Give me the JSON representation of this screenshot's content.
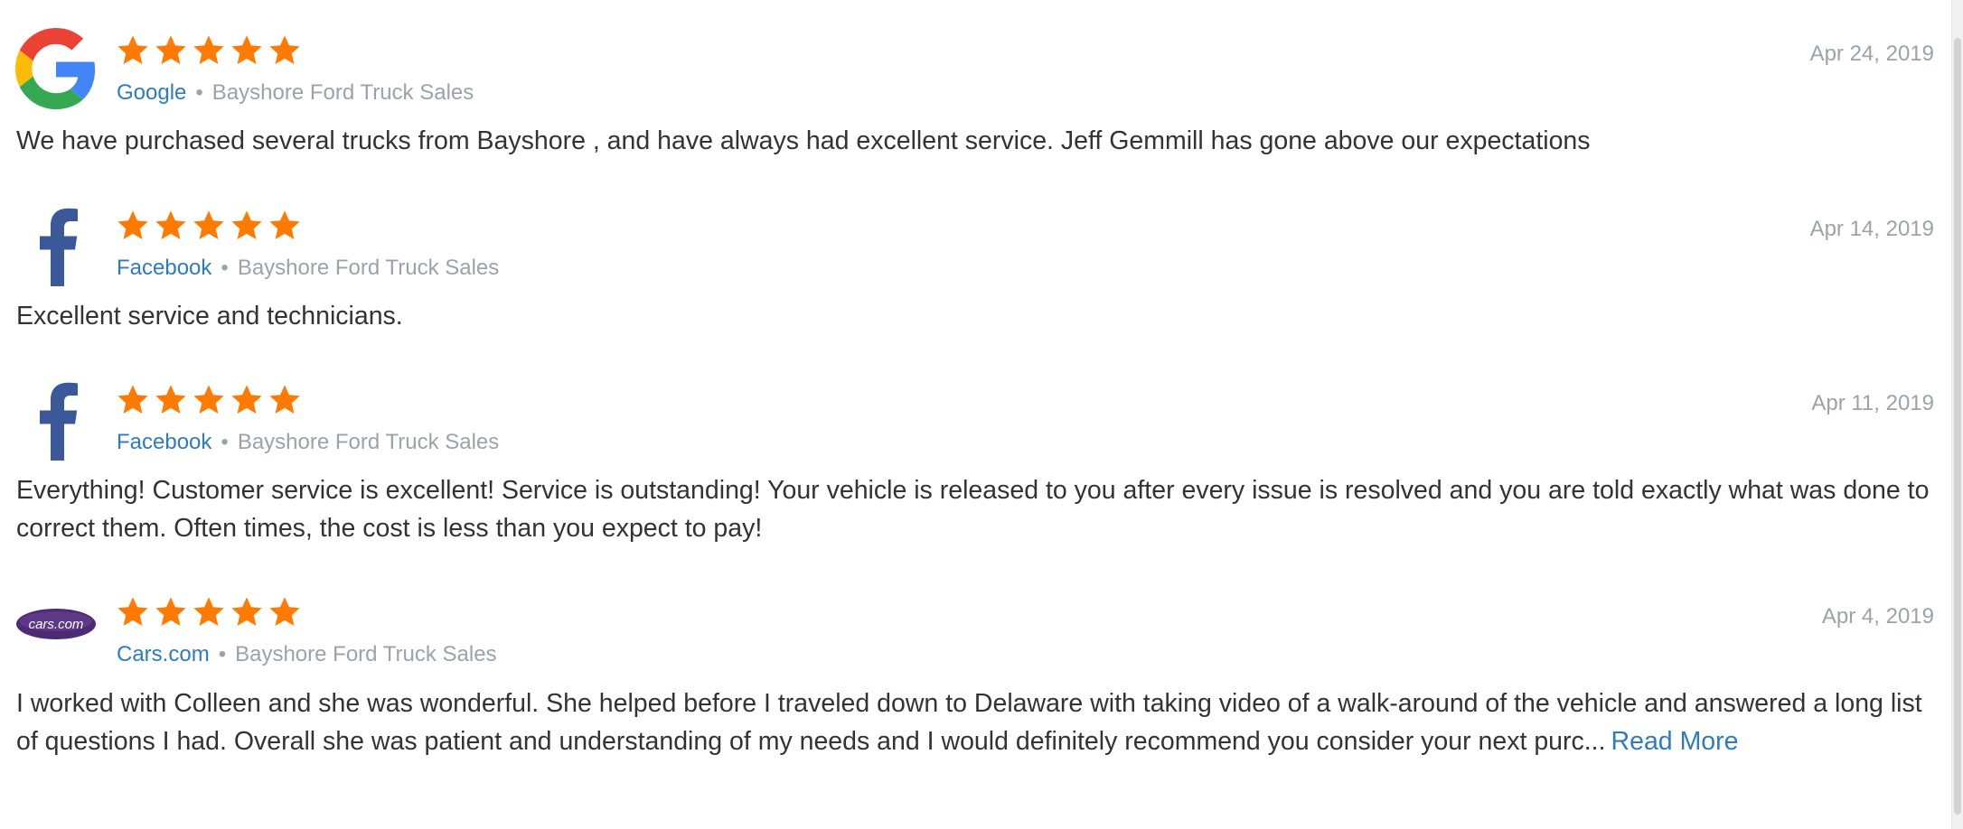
{
  "reviews": [
    {
      "source": "Google",
      "business": "Bayshore Ford Truck Sales",
      "date": "Apr 24, 2019",
      "rating": 5,
      "text": "We have purchased several trucks from Bayshore , and have always had excellent service. Jeff Gemmill has gone above our expectations",
      "icon": "google-icon"
    },
    {
      "source": "Facebook",
      "business": "Bayshore Ford Truck Sales",
      "date": "Apr 14, 2019",
      "rating": 5,
      "text": "Excellent service and technicians.",
      "icon": "facebook-icon"
    },
    {
      "source": "Facebook",
      "business": "Bayshore Ford Truck Sales",
      "date": "Apr 11, 2019",
      "rating": 5,
      "text": "Everything! Customer service is excellent! Service is outstanding! Your vehicle is released to you after every issue is resolved and you are told exactly what was done to correct them. Often times, the cost is less than you expect to pay!",
      "icon": "facebook-icon"
    },
    {
      "source": "Cars.com",
      "business": "Bayshore Ford Truck Sales",
      "date": "Apr 4, 2019",
      "rating": 5,
      "text": "I worked with Colleen and she was wonderful. She helped before I traveled down to Delaware with taking video of a walk-around of the vehicle and answered a long list of questions I had. Overall she was patient and understanding of my needs and I would definitely recommend you consider your next purc...",
      "read_more": "Read More",
      "icon": "cars-com-icon",
      "logo_text": "cars.com"
    }
  ],
  "separator": "•",
  "colors": {
    "star": "#ff7a00",
    "link": "#2f7bbf",
    "muted": "#9aa3ab",
    "text": "#333333",
    "facebook": "#3b5998",
    "carscom": "#4c2a74"
  }
}
